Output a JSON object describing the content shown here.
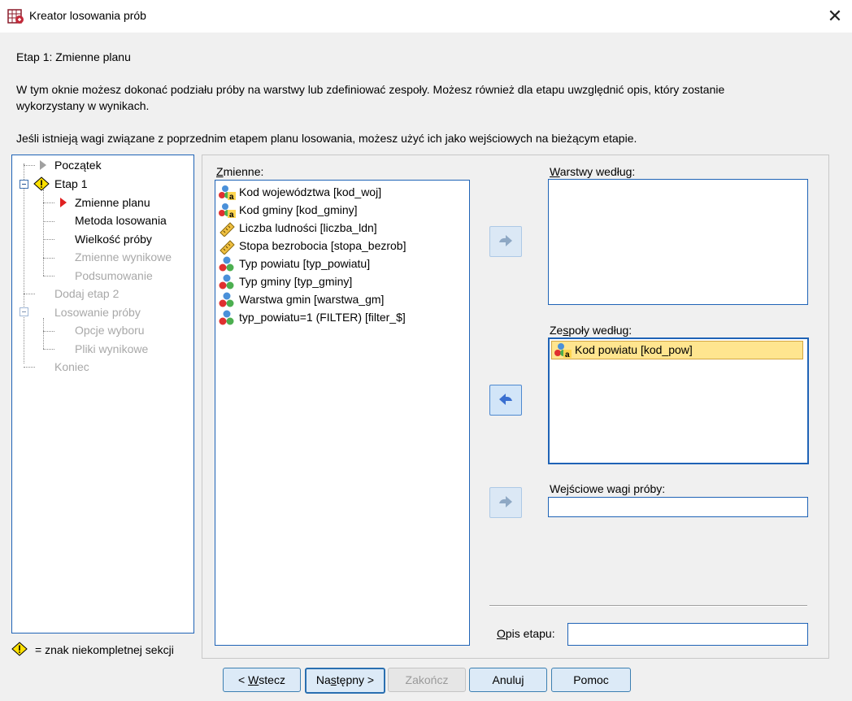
{
  "window": {
    "title": "Kreator losowania prób"
  },
  "header": {
    "step_title": "Etap 1: Zmienne planu",
    "description_line1": "W tym oknie możesz dokonać podziału próby na warstwy lub zdefiniować zespoły. Możesz również dla etapu uwzględnić opis, który zostanie",
    "description_line2": "wykorzystany w wynikach.",
    "weights_note": "Jeśli istnieją wagi związane z poprzednim etapem planu losowania, możesz użyć ich jako wejściowych na bieżącym etapie."
  },
  "tree": {
    "items": [
      {
        "label": "Początek"
      },
      {
        "label": "Etap 1"
      },
      {
        "label": "Zmienne planu"
      },
      {
        "label": "Metoda losowania"
      },
      {
        "label": "Wielkość próby"
      },
      {
        "label": "Zmienne wynikowe"
      },
      {
        "label": "Podsumowanie"
      },
      {
        "label": "Dodaj etap 2"
      },
      {
        "label": "Losowanie próby"
      },
      {
        "label": "Opcje wyboru"
      },
      {
        "label": "Pliki wynikowe"
      },
      {
        "label": "Koniec"
      }
    ],
    "legend": "= znak niekompletnej sekcji"
  },
  "variables": {
    "label_first": "Z",
    "label_rest": "mienne:",
    "items": [
      {
        "label": "Kod województwa [kod_woj]",
        "icon": "nominal-string-icon"
      },
      {
        "label": "Kod gminy [kod_gminy]",
        "icon": "nominal-string-icon"
      },
      {
        "label": "Liczba ludności [liczba_ldn]",
        "icon": "scale-ruler-icon"
      },
      {
        "label": "Stopa bezrobocia [stopa_bezrob]",
        "icon": "scale-ruler-icon"
      },
      {
        "label": "Typ powiatu [typ_powiatu]",
        "icon": "nominal-icon"
      },
      {
        "label": "Typ gminy [typ_gminy]",
        "icon": "nominal-icon"
      },
      {
        "label": "Warstwa gmin [warstwa_gm]",
        "icon": "nominal-icon"
      },
      {
        "label": "typ_powiatu=1 (FILTER) [filter_$]",
        "icon": "nominal-icon"
      }
    ]
  },
  "strata": {
    "label_first": "W",
    "label_rest": "arstwy według:"
  },
  "clusters": {
    "label_pre": "Ze",
    "label_ul": "s",
    "label_post": "poły według:",
    "items": [
      {
        "label": "Kod powiatu [kod_pow]",
        "icon": "nominal-string-icon"
      }
    ]
  },
  "input_weights": {
    "label_pre": "We",
    "label_ul": "j",
    "label_post": "ściowe wagi próby:",
    "value": ""
  },
  "stage_label": {
    "label_first": "O",
    "label_rest": "pis etapu:",
    "value": ""
  },
  "buttons": {
    "back_pre": "< ",
    "back_ul": "W",
    "back_post": "stecz",
    "next_pre": "Na",
    "next_ul": "s",
    "next_post": "tępny >",
    "finish": "Zakończ",
    "cancel": "Anuluj",
    "help": "Pomoc"
  },
  "colors": {
    "accent": "#1f63b6",
    "selection": "#ffe58f",
    "warning": "#ffe000",
    "arrow_current": "#e02020"
  }
}
